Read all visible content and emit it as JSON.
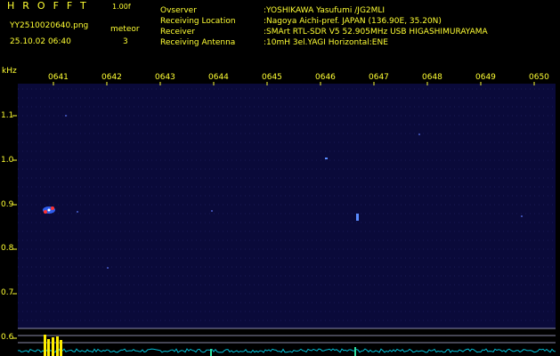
{
  "header": {
    "brand": "HROFFT",
    "version": "1.00f",
    "filename": "YY2510020640.png",
    "timestamp": "25.10.02 06:40",
    "meteor_label": "meteor",
    "meteor_count": "3"
  },
  "station": {
    "rows": [
      {
        "key": "Ovserver",
        "value": ":YOSHIKAWA Yasufumi /JG2MLI"
      },
      {
        "key": "Receiving Location",
        "value": ":Nagoya Aichi-pref. JAPAN (136.90E, 35.20N)"
      },
      {
        "key": "Receiver",
        "value": ":SMArt RTL-SDR V5 52.905MHz USB HIGASHIMURAYAMA"
      },
      {
        "key": "Receiving Antenna",
        "value": ":10mH 3el.YAGI Horizontal:ENE"
      }
    ]
  },
  "axes": {
    "y_unit": "kHz",
    "y_ticks": [
      "1.1",
      "1.0",
      "0.9",
      "0.8",
      "0.7",
      "0.6"
    ],
    "x_ticks": [
      "0641",
      "0642",
      "0643",
      "0644",
      "0645",
      "0646",
      "0647",
      "0648",
      "0649",
      "0650"
    ]
  },
  "colors": {
    "text": "#ffff33",
    "background": "#000000",
    "spectrogram": "#0a0a3a",
    "baseline": "#00bcd4",
    "signal_peak": "#ffee00"
  },
  "chart_data": {
    "type": "heatmap",
    "x_range": [
      "0641",
      "0650"
    ],
    "y_range_khz": [
      0.6,
      1.15
    ],
    "ylabel": "kHz",
    "meteor_echoes": [
      {
        "time": "0641",
        "freq_khz": 0.885
      },
      {
        "time": "0645.8",
        "freq_khz": 1.0
      },
      {
        "time": "0646.7",
        "freq_khz": 0.88
      }
    ]
  }
}
